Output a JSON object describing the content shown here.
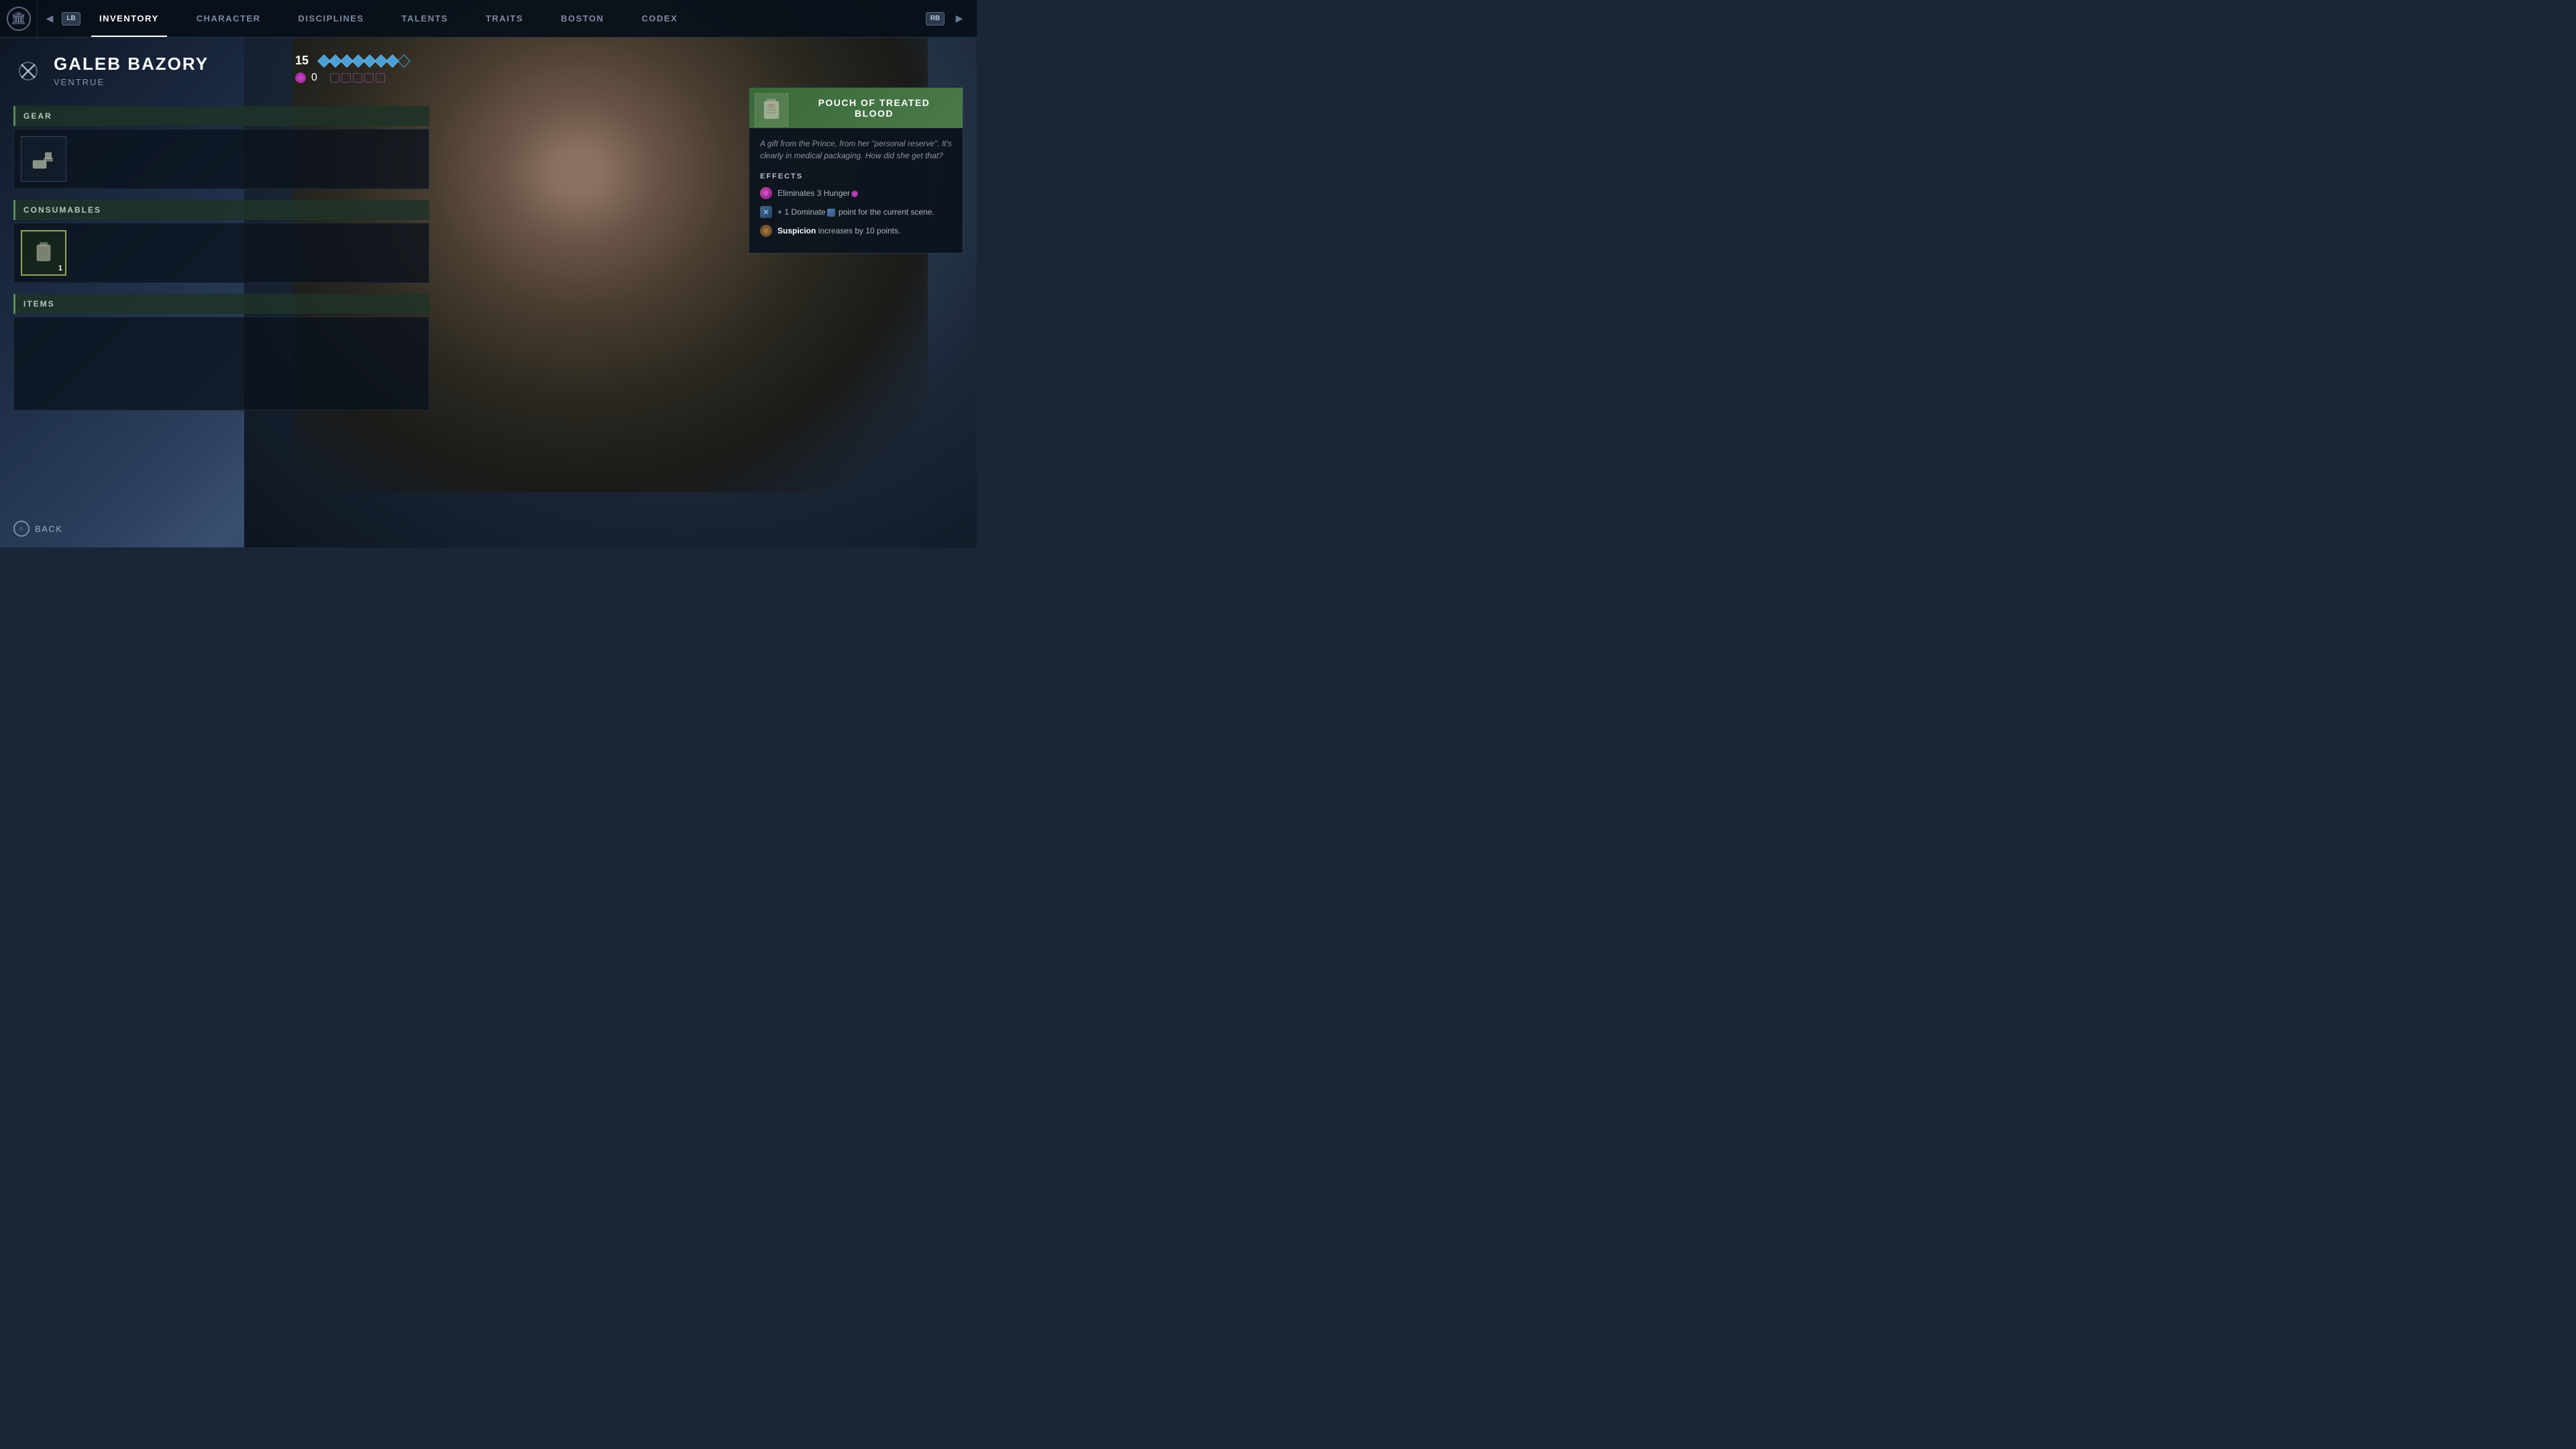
{
  "background": {
    "colors": [
      "#0d1520",
      "#1a2840",
      "#2a3d5a"
    ]
  },
  "nav": {
    "logo_icon": "🏛",
    "lb_label": "LB",
    "rb_label": "RB",
    "left_arrow": "◀",
    "right_arrow": "▶",
    "tabs": [
      {
        "label": "INVENTORY",
        "active": true
      },
      {
        "label": "CHARACTER",
        "active": false
      },
      {
        "label": "DISCIPLINES",
        "active": false
      },
      {
        "label": "TALENTS",
        "active": false
      },
      {
        "label": "TRAITS",
        "active": false
      },
      {
        "label": "BOSTON",
        "active": false
      },
      {
        "label": "CODEX",
        "active": false
      }
    ]
  },
  "character": {
    "name": "GALEB BAZORY",
    "clan": "VENTRUE",
    "level": 15,
    "close_label": "✕",
    "diamonds_filled": 7,
    "diamonds_total": 8,
    "hunger_value": 0,
    "hunger_pips": 5
  },
  "sections": {
    "gear": {
      "title": "GEAR"
    },
    "consumables": {
      "title": "CONSUMABLES"
    },
    "items": {
      "title": "ITEMS"
    }
  },
  "back": {
    "label": "BACK",
    "circle_symbol": "○"
  },
  "detail_panel": {
    "title_line1": "POUCH OF TREATED",
    "title_line2": "BLOOD",
    "description": "A gift from the Prince, from her \"personal reserve\". It's clearly in medical packaging. How did she get that?",
    "effects_label": "EFFECTS",
    "effects": [
      {
        "type": "hunger",
        "text": "Eliminates 3 Hunger"
      },
      {
        "type": "dominate",
        "text": "+ 1 Dominate point for the current scene."
      },
      {
        "type": "suspicion",
        "text_prefix": "",
        "text_highlight": "Suspicion",
        "text_suffix": " increases by 10 points."
      }
    ]
  }
}
